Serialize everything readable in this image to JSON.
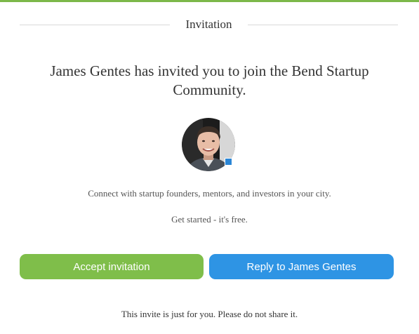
{
  "header": {
    "title": "Invitation"
  },
  "invite": {
    "headline": "James Gentes has invited you to join the Bend Startup Community.",
    "line1": "Connect with startup founders, mentors, and investors in your city.",
    "line2": "Get started - it's free."
  },
  "buttons": {
    "accept_label": "Accept invitation",
    "reply_label": "Reply to James Gentes"
  },
  "footer": {
    "note": "This invite is just for you. Please do not share it."
  },
  "colors": {
    "accent_green": "#7fbe4a",
    "accent_blue": "#2e94e4",
    "top_bar": "#7cb84a"
  },
  "icons": {
    "avatar": "user-photo",
    "badge": "linkedin-badge-icon"
  }
}
